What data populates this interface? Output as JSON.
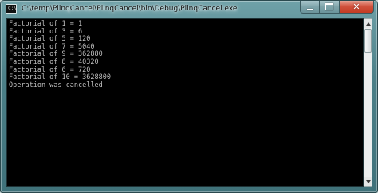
{
  "window": {
    "title": "C:\\temp\\PlinqCancel\\PlinqCancel\\bin\\Debug\\PlinqCancel.exe",
    "icon": "console-app-icon",
    "icon_glyph": "C:\\"
  },
  "caption_buttons": {
    "minimize": "minimize-icon",
    "maximize": "maximize-icon",
    "close": "close-icon",
    "close_glyph": "✕"
  },
  "console": {
    "background": "#000000",
    "foreground": "#c0c0c0",
    "lines": [
      "Factorial of 1 = 1",
      "Factorial of 3 = 6",
      "Factorial of 5 = 120",
      "Factorial of 7 = 5040",
      "Factorial of 9 = 362880",
      "Factorial of 8 = 40320",
      "Factorial of 6 = 720",
      "Factorial of 10 = 3628800",
      "Operation was cancelled"
    ]
  },
  "colors": {
    "frame": "#4c8088",
    "close_button": "#c23b23"
  }
}
